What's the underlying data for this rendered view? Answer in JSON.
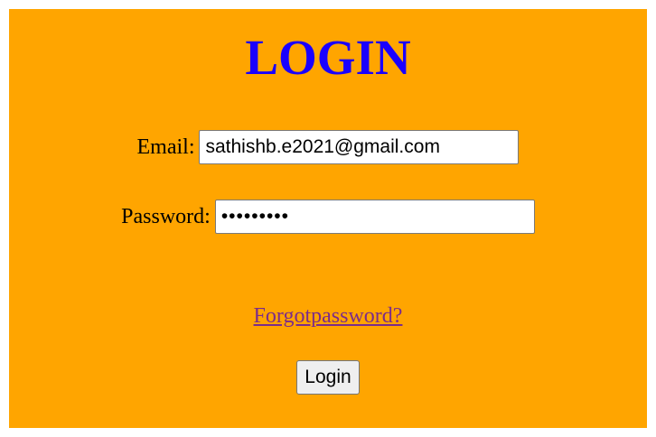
{
  "page": {
    "title": "LOGIN",
    "background_color": "#ffa500",
    "title_color": "#1a00ff"
  },
  "form": {
    "email_label": "Email:",
    "email_value": "sathishb.e2021@gmail.com",
    "password_label": "Password:",
    "password_value": "sathish12",
    "forgot_link": "Forgotpassword?",
    "forgot_link_color": "#7b2c8a",
    "submit_label": "Login"
  }
}
